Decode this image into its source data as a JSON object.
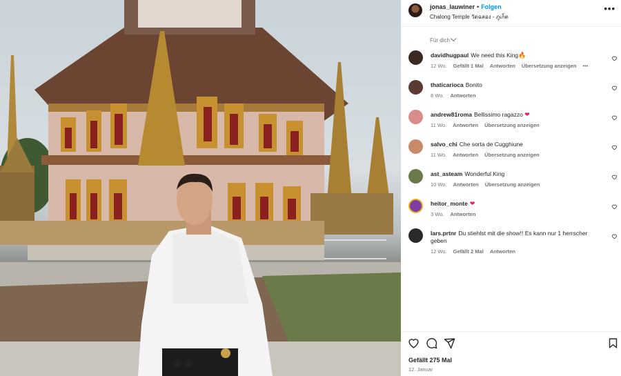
{
  "post": {
    "username": "jonas_lauwiner",
    "separator": "•",
    "follow_label": "Folgen",
    "location": "Chalong Temple วัดฉลอง - ภูเก็ต",
    "more_glyph": "•••",
    "sort_label": "Für dich"
  },
  "comments": [
    {
      "user": "davidhugpaul",
      "text": "We need this King",
      "emoji": "🔥",
      "emoji_color": "#f4781a",
      "age": "12 Wo.",
      "likes": "Gefällt 1 Mal",
      "reply": "Antworten",
      "translate": "Übersetzung anzeigen",
      "more": "•••",
      "avatar_color": "#3b2a22"
    },
    {
      "user": "thaticarioca",
      "text": "Bonito",
      "emoji": "",
      "age": "8 Wo.",
      "likes": "",
      "reply": "Antworten",
      "translate": "",
      "more": "",
      "avatar_color": "#5a3b34"
    },
    {
      "user": "andrew81roma",
      "text": "Bellissimo ragazzo",
      "emoji": "❤",
      "emoji_color": "#e0245e",
      "age": "11 Wo.",
      "likes": "",
      "reply": "Antworten",
      "translate": "Übersetzung anzeigen",
      "more": "",
      "avatar_color": "#d98c8c"
    },
    {
      "user": "salvo_chi",
      "text": "Che sorta de Cugghiune",
      "emoji": "",
      "age": "11 Wo.",
      "likes": "",
      "reply": "Antworten",
      "translate": "Übersetzung anzeigen",
      "more": "",
      "avatar_color": "#c98a6a"
    },
    {
      "user": "ast_asteam",
      "text": "Wonderful King",
      "emoji": "",
      "age": "10 Wo.",
      "likes": "",
      "reply": "Antworten",
      "translate": "Übersetzung anzeigen",
      "more": "",
      "avatar_color": "#6b7a4a"
    },
    {
      "user": "heitor_monte",
      "text": "",
      "emoji": "❤",
      "emoji_color": "#e0245e",
      "age": "3 Wo.",
      "likes": "",
      "reply": "Antworten",
      "translate": "",
      "more": "",
      "avatar_color": "#7a3fa0"
    },
    {
      "user": "lars.prtnr",
      "text": "Du stiehlst mit die show!! Es kann nur 1 herrscher geben",
      "emoji": "",
      "age": "12 Wo.",
      "likes": "Gefällt 2 Mal",
      "reply": "Antworten",
      "translate": "",
      "more": "",
      "avatar_color": "#2a2a2a"
    }
  ],
  "footer": {
    "likes": "Gefällt 275 Mal",
    "date": "12. Januar"
  },
  "icons": {
    "like": "heart-icon",
    "comment": "comment-icon",
    "share": "send-icon",
    "save": "bookmark-icon",
    "more": "more-icon",
    "sort": "chevron-down-icon"
  }
}
